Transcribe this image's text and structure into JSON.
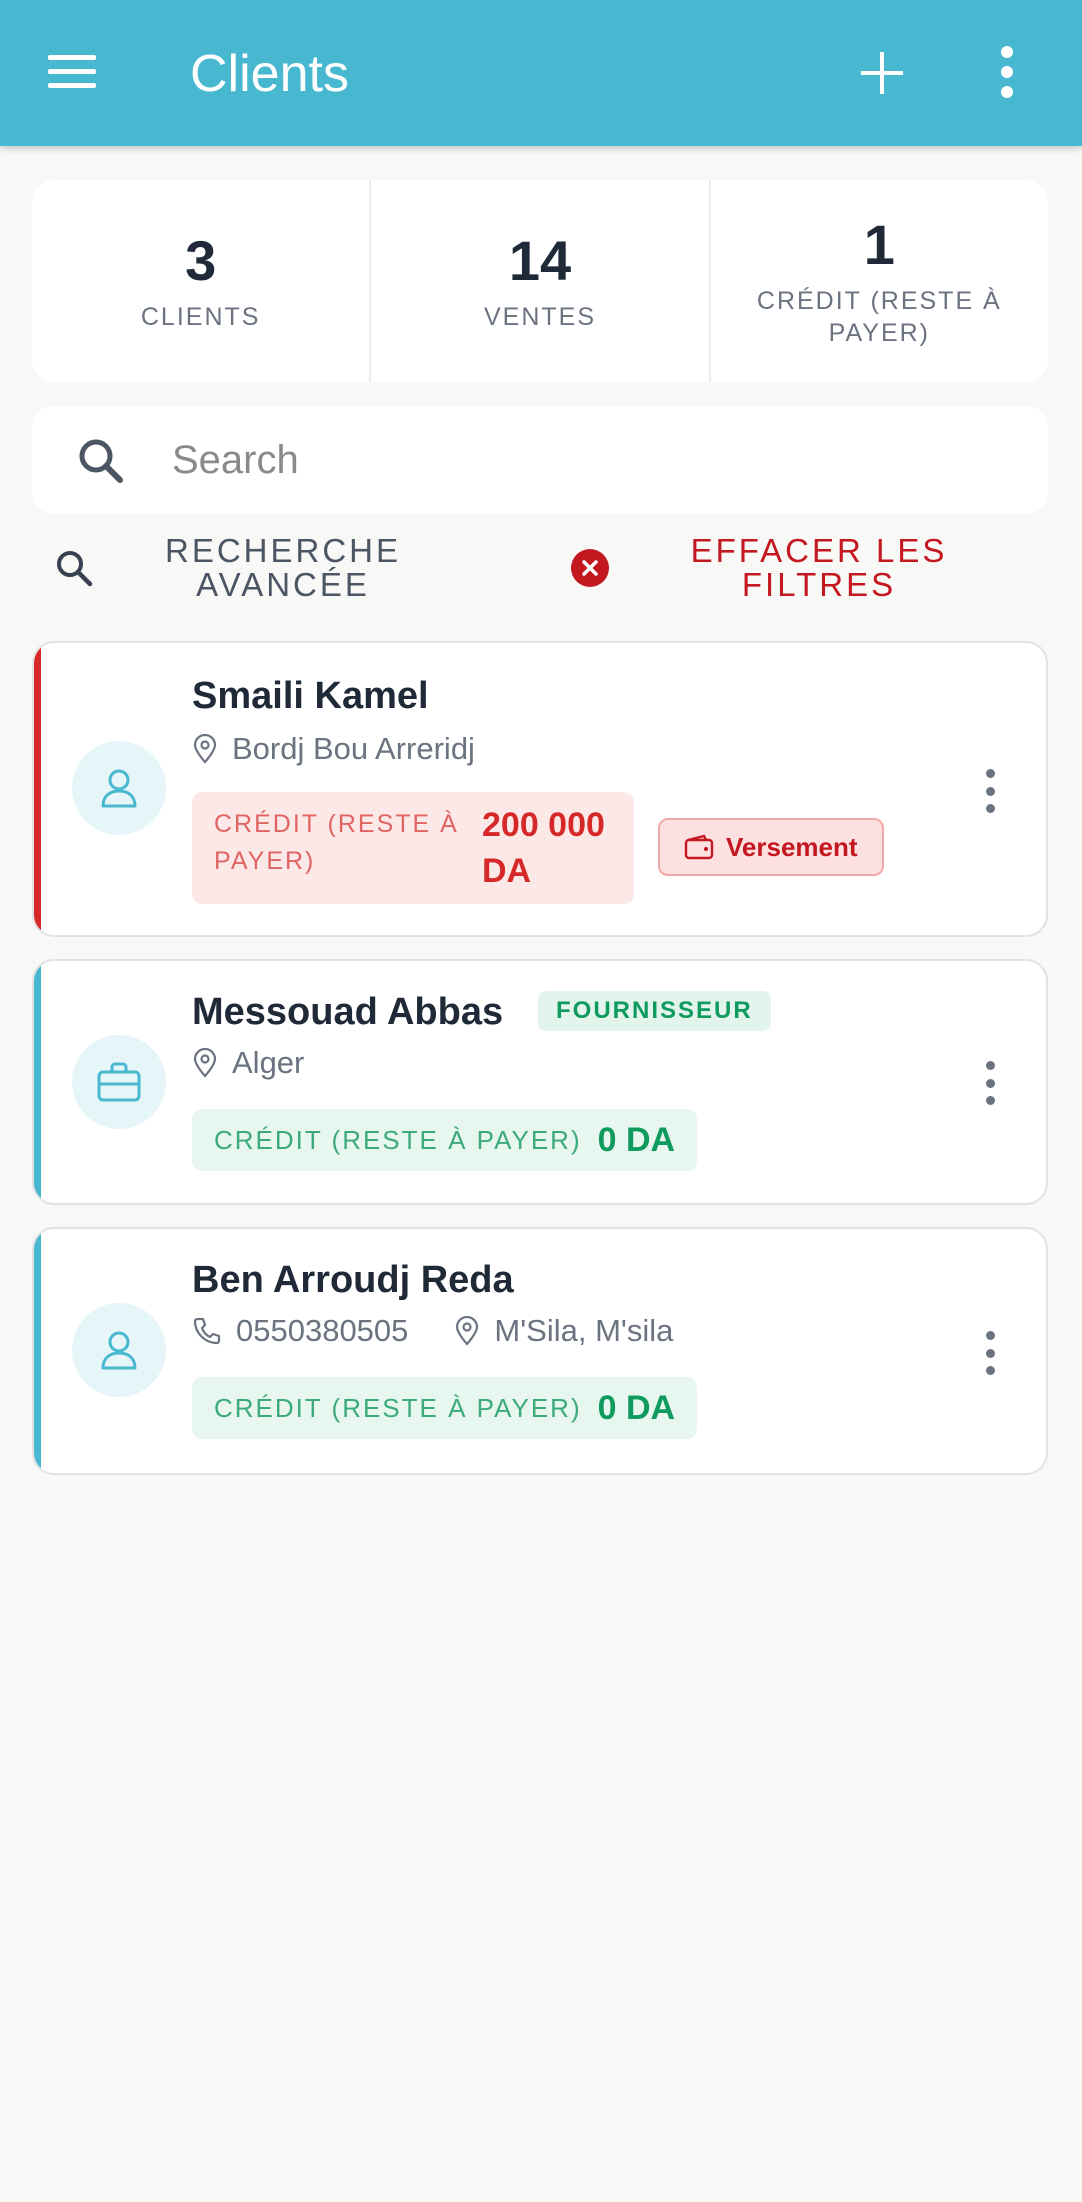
{
  "colors": {
    "appbar": "#48b8d0",
    "danger": "#c41820",
    "success": "#0f9a5e",
    "accent_red": "#d62828",
    "accent_teal": "#48b8d0"
  },
  "appbar": {
    "title": "Clients",
    "icons": [
      "menu-icon",
      "add-icon",
      "more-vert-icon"
    ]
  },
  "stats": [
    {
      "value": "3",
      "label": "CLIENTS"
    },
    {
      "value": "14",
      "label": "VENTES"
    },
    {
      "value": "1",
      "label": "CRÉDIT (RESTE À PAYER)"
    }
  ],
  "search": {
    "placeholder": "Search",
    "value": ""
  },
  "filters": {
    "advanced_label": "RECHERCHE AVANCÉE",
    "clear_label": "EFFACER LES FILTRES"
  },
  "clients": [
    {
      "name": "Smaili Kamel",
      "location": "Bordj Bou Arreridj",
      "credit_label": "CRÉDIT (RESTE À PAYER)",
      "credit_value": "200 000 DA",
      "action_label": "Versement",
      "avatar_icon": "person-icon"
    },
    {
      "name": "Messouad Abbas",
      "tag": "FOURNISSEUR",
      "location": "Alger",
      "credit_label": "CRÉDIT (RESTE À PAYER)",
      "credit_value": "0 DA",
      "avatar_icon": "briefcase-icon"
    },
    {
      "name": "Ben Arroudj Reda",
      "phone": "0550380505",
      "location": "M'Sila, M'sila",
      "credit_label": "CRÉDIT (RESTE À PAYER)",
      "credit_value": "0 DA",
      "avatar_icon": "person-icon"
    }
  ]
}
